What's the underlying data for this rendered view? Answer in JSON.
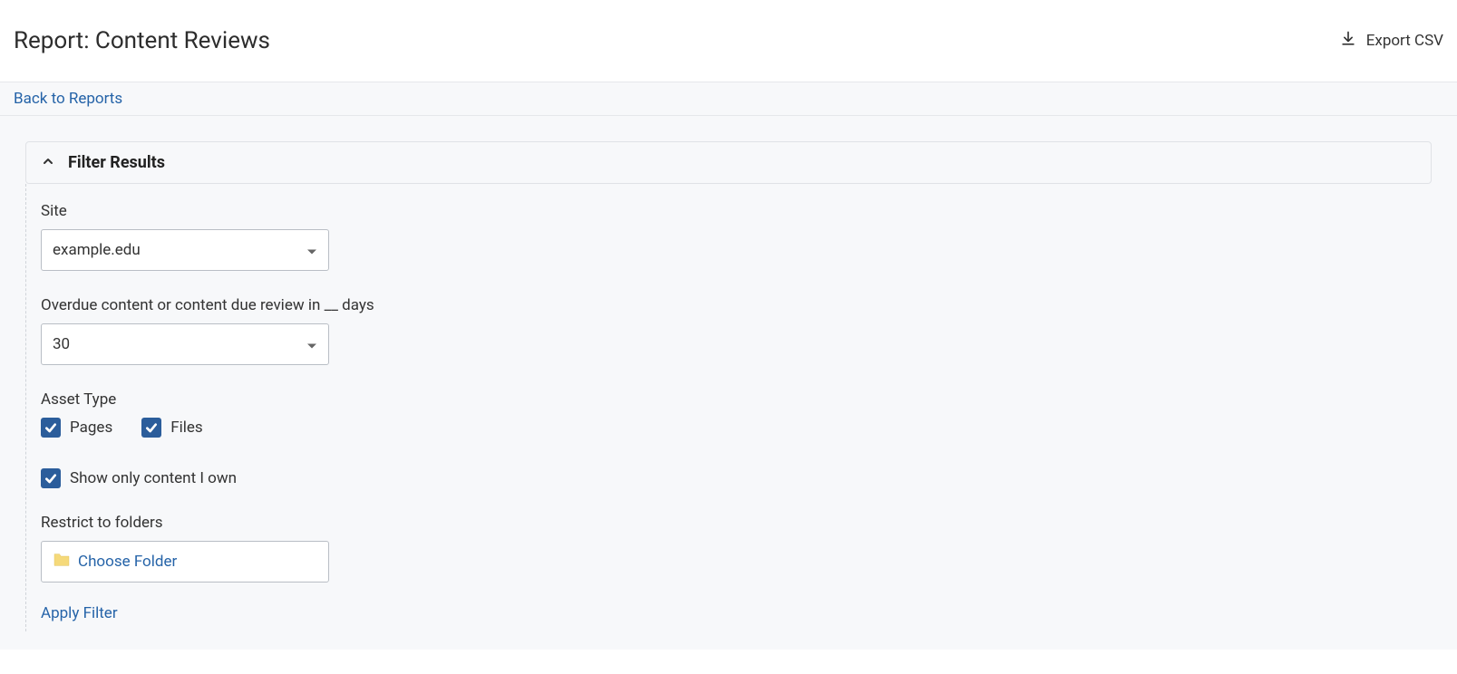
{
  "header": {
    "title": "Report: Content Reviews",
    "export_label": "Export CSV"
  },
  "subbar": {
    "back_label": "Back to Reports"
  },
  "filter": {
    "title": "Filter Results",
    "site": {
      "label": "Site",
      "value": "example.edu"
    },
    "days": {
      "label": "Overdue content or content due review in __ days",
      "value": "30"
    },
    "asset_type": {
      "label": "Asset Type",
      "pages_label": "Pages",
      "files_label": "Files"
    },
    "own_only_label": "Show only content I own",
    "restrict": {
      "label": "Restrict to folders",
      "choose_label": "Choose Folder"
    },
    "apply_label": "Apply Filter"
  }
}
